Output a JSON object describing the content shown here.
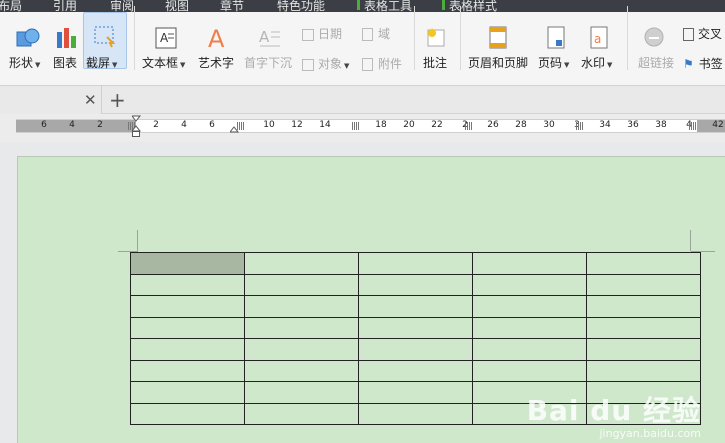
{
  "menu": {
    "tabs": [
      "布局",
      "引用",
      "审阅",
      "视图",
      "章节",
      "特色功能"
    ],
    "context_tabs": [
      "表格工具",
      "表格样式"
    ]
  },
  "ribbon": {
    "shape": "形状",
    "chart": "图表",
    "screenshot": "截屏",
    "textbox": "文本框",
    "wordart": "艺术字",
    "dropcap": "首字下沉",
    "date": "日期",
    "object": "对象",
    "field": "域",
    "attachment": "附件",
    "comment": "批注",
    "header_footer": "页眉和页脚",
    "page_number": "页码",
    "watermark": "水印",
    "hyperlink": "超链接",
    "crossref": "交叉",
    "bookmark": "书签"
  },
  "doc_tab": {
    "new_tab": "+"
  },
  "ruler": {
    "labels": [
      "6",
      "4",
      "2",
      "2",
      "4",
      "6",
      "10",
      "12",
      "14",
      "18",
      "20",
      "22",
      "2",
      "26",
      "28",
      "30",
      "3",
      "34",
      "36",
      "38",
      "4",
      "42"
    ]
  },
  "table": {
    "rows": 8,
    "cols": 5,
    "selected_cell": [
      0,
      0
    ]
  },
  "watermark": {
    "main": "Bai du 经验",
    "sub": "jingyan.baidu.com"
  },
  "colors": {
    "page": "#cfe8cc",
    "context_accent": "#4cae3a",
    "selected_cell": "#a7b7a2"
  }
}
